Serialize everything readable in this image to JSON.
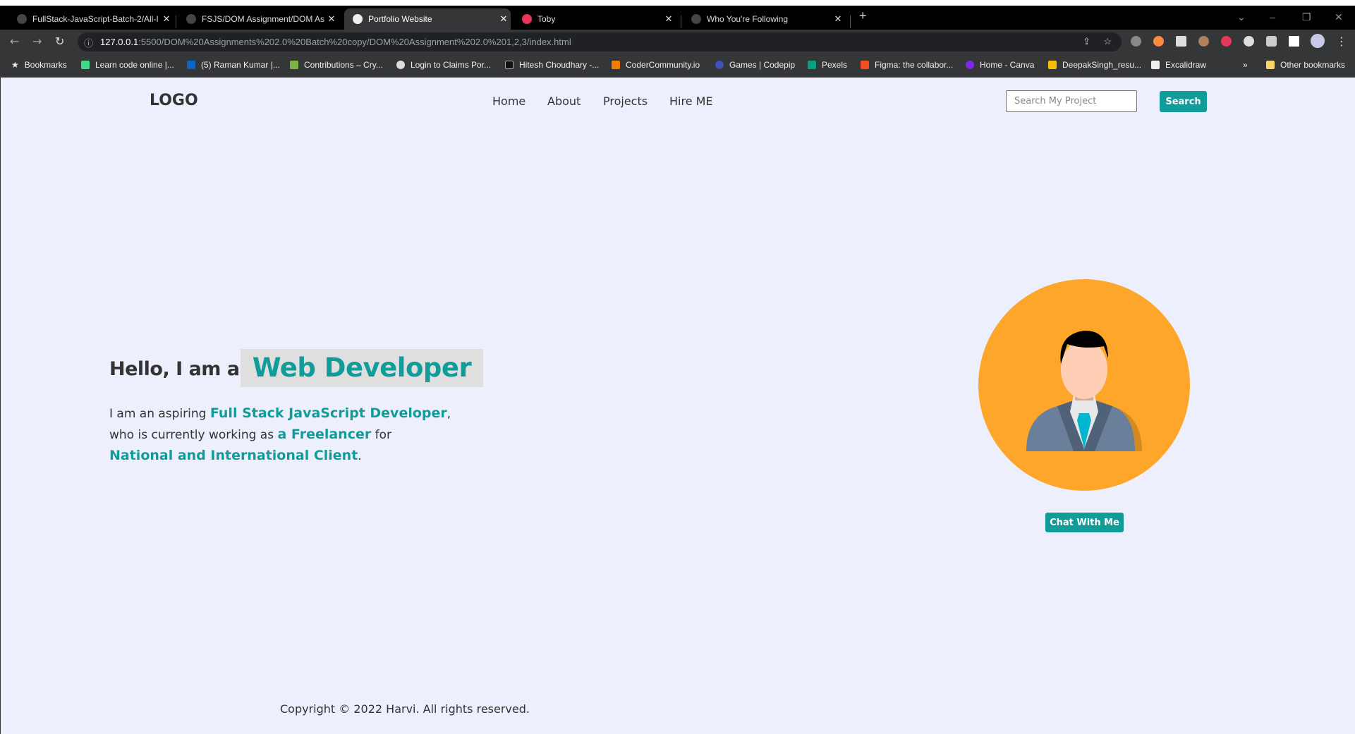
{
  "browser": {
    "tabs": [
      {
        "title": "FullStack-JavaScript-Batch-2/All-I",
        "icon": "github-icon"
      },
      {
        "title": "FSJS/DOM Assignment/DOM Ass",
        "icon": "github-icon"
      },
      {
        "title": "Portfolio Website",
        "icon": "globe-icon",
        "active": true
      },
      {
        "title": "Toby",
        "icon": "toby-icon"
      },
      {
        "title": "Who You're Following",
        "icon": "github-icon"
      }
    ],
    "url_host": "127.0.0.1",
    "url_rest": ":5500/DOM%20Assignments%202.0%20Batch%20copy/DOM%20Assignment%202.0%201,2,3/index.html",
    "bookmarks": [
      {
        "label": "Bookmarks",
        "color": "#ffffff"
      },
      {
        "label": "Learn code online |...",
        "color": "#3ddc84"
      },
      {
        "label": "(5) Raman Kumar |...",
        "color": "#0a66c2"
      },
      {
        "label": "Contributions – Cry...",
        "color": "#7cb342"
      },
      {
        "label": "Login to Claims Por...",
        "color": "#dddddd"
      },
      {
        "label": "Hitesh Choudhary -...",
        "color": "#111111"
      },
      {
        "label": "CoderCommunity.io",
        "color": "#f57c00"
      },
      {
        "label": "Games | Codepip",
        "color": "#3f51b5"
      },
      {
        "label": "Pexels",
        "color": "#05a081"
      },
      {
        "label": "Figma: the collabor...",
        "color": "#f24e1e"
      },
      {
        "label": "Home - Canva",
        "color": "#7d2ae8"
      },
      {
        "label": "DeepakSingh_resu...",
        "color": "#fbbc04"
      },
      {
        "label": "Excalidraw",
        "color": "#eeeeee"
      }
    ],
    "other_bookmarks": "Other bookmarks",
    "overflow": "»"
  },
  "header": {
    "logo": "LOGO",
    "nav": [
      "Home",
      "About",
      "Projects",
      "Hire ME"
    ],
    "search_placeholder": "Search My Project",
    "search_value": "",
    "search_button": "Search"
  },
  "hero": {
    "greeting": "Hello, I am a",
    "role": "Web Developer",
    "p1": "I am an aspiring ",
    "h1": "Full Stack JavaScript Developer",
    "p2": ",",
    "p3": "who is currently working as ",
    "h2": "a Freelancer",
    "p4": " for",
    "h3": "National and International Client",
    "p5": ".",
    "chat_button": "Chat With Me"
  },
  "footer": {
    "copyright": "Copyright © 2022 Harvi. All rights reserved."
  },
  "colors": {
    "accent": "#129c99",
    "avatar_bg": "#fea62a",
    "page_bg": "#edf0fc"
  }
}
